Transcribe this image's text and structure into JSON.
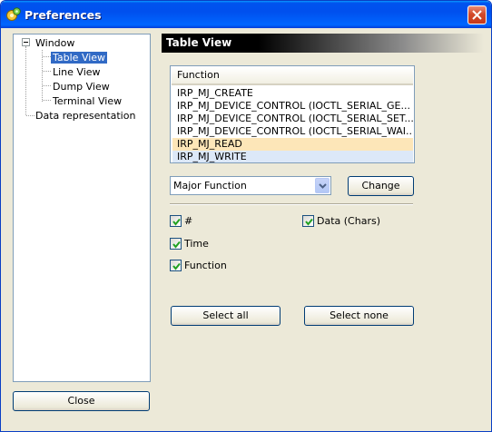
{
  "window": {
    "title": "Preferences",
    "icon": "app-gear-icon"
  },
  "tree": {
    "items": [
      {
        "label": "Window",
        "expanded": true
      },
      {
        "label": "Table View",
        "selected": true
      },
      {
        "label": "Line View"
      },
      {
        "label": "Dump View"
      },
      {
        "label": "Terminal View"
      },
      {
        "label": "Data representation"
      }
    ]
  },
  "section": {
    "title": "Table View"
  },
  "listview": {
    "header": "Function",
    "rows": [
      "IRP_MJ_CREATE",
      "IRP_MJ_DEVICE_CONTROL (IOCTL_SERIAL_GE...",
      "IRP_MJ_DEVICE_CONTROL (IOCTL_SERIAL_SET...",
      "IRP_MJ_DEVICE_CONTROL (IOCTL_SERIAL_WAI...",
      "IRP_MJ_READ",
      "IRP_MJ_WRITE"
    ],
    "row_colors": [
      "#ffffff",
      "#ffffff",
      "#ffffff",
      "#ffffff",
      "#fde6b8",
      "#dce8f8"
    ]
  },
  "color_by": {
    "selected": "Major Function",
    "change_label": "Change"
  },
  "columns": {
    "hash": {
      "label": "#",
      "checked": true
    },
    "time": {
      "label": "Time",
      "checked": true
    },
    "function": {
      "label": "Function",
      "checked": true
    },
    "data_chars": {
      "label": "Data (Chars)",
      "checked": true
    }
  },
  "actions": {
    "select_all": "Select all",
    "select_none": "Select none",
    "close": "Close"
  },
  "colors": {
    "title_bar": "#0054e3",
    "selection": "#316ac5",
    "dialog_bg": "#ece9d8"
  }
}
